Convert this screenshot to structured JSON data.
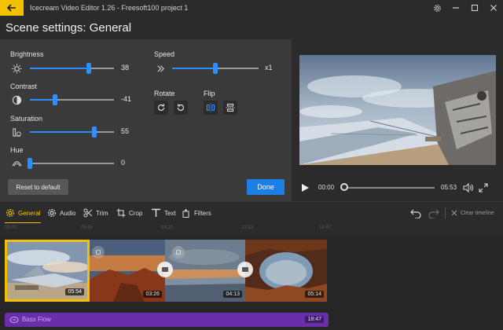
{
  "window": {
    "title": "Icecream Video Editor 1.26 - Freesoft100 project 1"
  },
  "page_title": "Scene settings: General",
  "settings": {
    "brightness": {
      "label": "Brightness",
      "value": "38",
      "level": 0.7
    },
    "contrast": {
      "label": "Contrast",
      "value": "-41",
      "level": 0.3
    },
    "saturation": {
      "label": "Saturation",
      "value": "55",
      "level": 0.77
    },
    "hue": {
      "label": "Hue",
      "value": "0",
      "level": 0.0
    },
    "speed": {
      "label": "Speed",
      "value": "x1",
      "level": 0.5
    },
    "rotate_label": "Rotate",
    "flip_label": "Flip",
    "reset_label": "Reset to default",
    "done_label": "Done"
  },
  "player": {
    "current_time": "00:00",
    "total_time": "05:53",
    "progress": 0.0
  },
  "toolbar": {
    "tabs": [
      {
        "label": "General",
        "icon": "gear-icon",
        "active": true
      },
      {
        "label": "Audio",
        "icon": "audio-gear-icon",
        "active": false
      },
      {
        "label": "Trim",
        "icon": "scissors-icon",
        "active": false
      },
      {
        "label": "Crop",
        "icon": "crop-icon",
        "active": false
      },
      {
        "label": "Text",
        "icon": "text-icon",
        "active": false
      },
      {
        "label": "Filters",
        "icon": "filters-icon",
        "active": false
      }
    ],
    "clear_label": "Clear timeline"
  },
  "timeline": {
    "ruler_ticks": [
      "00:00",
      "05:54",
      "09:20",
      "13:33",
      "18:47"
    ],
    "clips": [
      {
        "duration": "05:54",
        "selected": true
      },
      {
        "duration": "03:26",
        "selected": false
      },
      {
        "duration": "04:13",
        "selected": false
      },
      {
        "duration": "05:14",
        "selected": false
      }
    ],
    "audio": {
      "label": "Bass Flow",
      "duration": "18:47"
    }
  },
  "colors": {
    "accent": "#f2c200",
    "primary": "#1b7fe6",
    "audio": "#6a2fa8"
  }
}
